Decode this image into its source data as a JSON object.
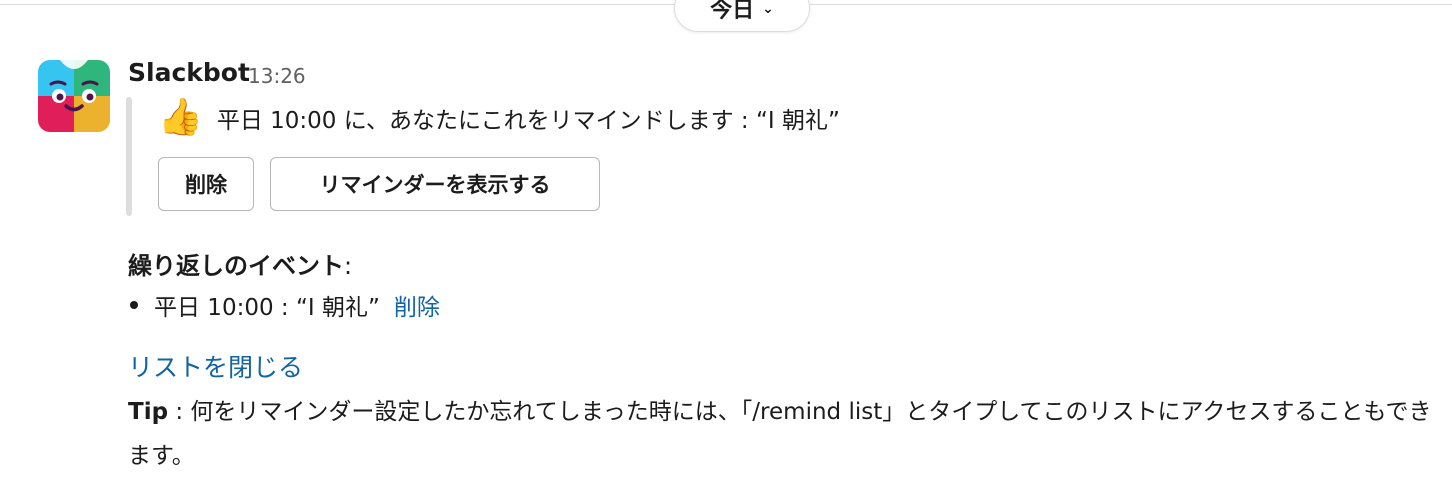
{
  "date_divider": {
    "label": "今日"
  },
  "message": {
    "sender": "Slackbot",
    "time": "13:26",
    "reminder_text": "平日 10:00  に、あなたにこれをリマインドします : “I 朝礼”",
    "buttons": {
      "delete": "削除",
      "show": "リマインダーを表示する"
    }
  },
  "recurring": {
    "heading": "繰り返しのイベント",
    "colon": ":",
    "items": [
      {
        "text": "平日 10:00  : “I 朝礼”",
        "delete_link": "削除"
      }
    ]
  },
  "close_list_link": "リストを閉じる",
  "tip": {
    "label": "Tip",
    "text": " : 何をリマインダー設定したか忘れてしまった時には、「/remind list」とタイプしてこのリストにアクセスすることもできます。"
  },
  "colors": {
    "link": "#1264a3",
    "text": "#1d1c1d",
    "muted": "#616061",
    "border": "#dddddd",
    "avatar": [
      "#36c5f0",
      "#2eb67d",
      "#e01e5a",
      "#ecb22e"
    ]
  },
  "icons": {
    "thumb": "thumbs-up-emoji",
    "chevron": "chevron-down-icon"
  }
}
